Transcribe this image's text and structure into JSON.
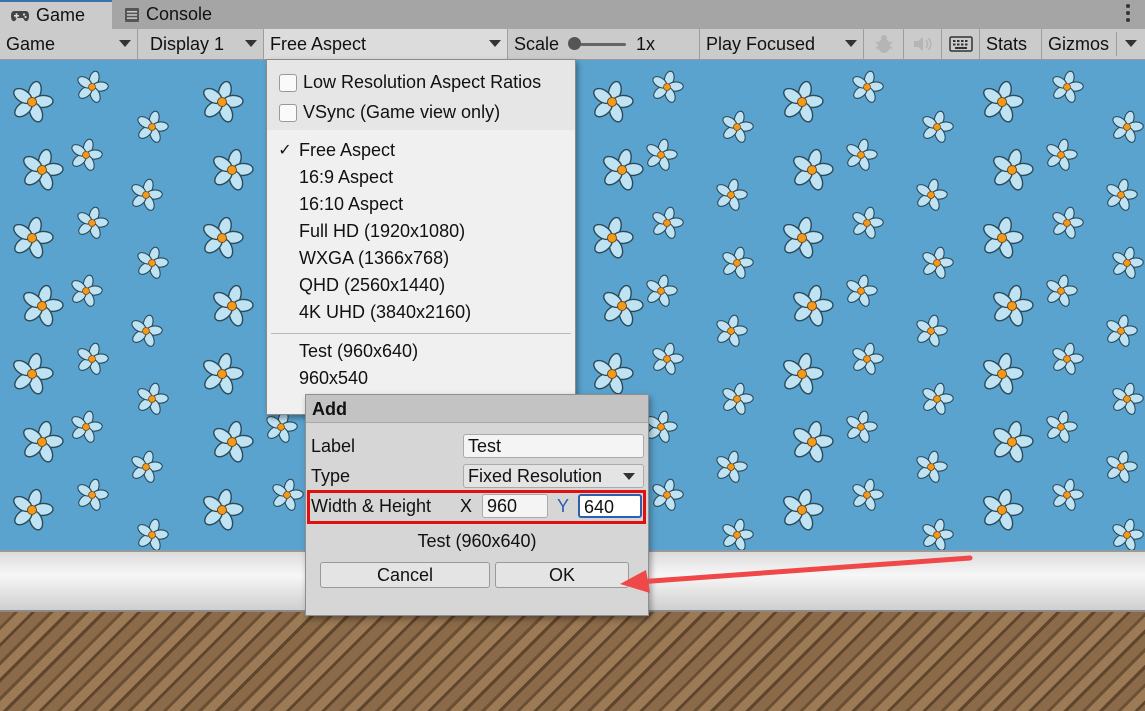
{
  "tabs": {
    "game_label": "Game",
    "console_label": "Console",
    "game_icon": "gamepad-icon",
    "console_icon": "console-list-icon"
  },
  "toolbar": {
    "view": "Game",
    "display": "Display 1",
    "aspect": "Free Aspect",
    "scale_label": "Scale",
    "scale_value": "1x",
    "play_mode": "Play Focused",
    "stats": "Stats",
    "gizmos": "Gizmos",
    "icons": [
      "bug-icon",
      "mute-audio-icon",
      "keyboard-icon"
    ]
  },
  "aspect_menu": {
    "options": [
      {
        "label": "Low Resolution Aspect Ratios",
        "checked": false
      },
      {
        "label": "VSync (Game view only)",
        "checked": false
      }
    ],
    "builtin": [
      {
        "label": "Free Aspect",
        "selected": true
      },
      {
        "label": "16:9 Aspect",
        "selected": false
      },
      {
        "label": "16:10 Aspect",
        "selected": false
      },
      {
        "label": "Full HD (1920x1080)",
        "selected": false
      },
      {
        "label": "WXGA (1366x768)",
        "selected": false
      },
      {
        "label": "QHD (2560x1440)",
        "selected": false
      },
      {
        "label": "4K UHD (3840x2160)",
        "selected": false
      }
    ],
    "custom": [
      {
        "label": "Test (960x640)"
      },
      {
        "label": "960x540"
      }
    ],
    "check_mark": "✓"
  },
  "add_dialog": {
    "title": "Add",
    "label_caption": "Label",
    "label_value": "Test",
    "type_caption": "Type",
    "type_value": "Fixed Resolution",
    "size_caption": "Width & Height",
    "x_caption": "X",
    "x_value": "960",
    "y_caption": "Y",
    "y_value": "640",
    "preview": "Test (960x640)",
    "cancel": "Cancel",
    "ok": "OK"
  },
  "colors": {
    "sky": "#5aa3cf",
    "highlight_box": "#e01010",
    "arrow": "#f04848"
  }
}
